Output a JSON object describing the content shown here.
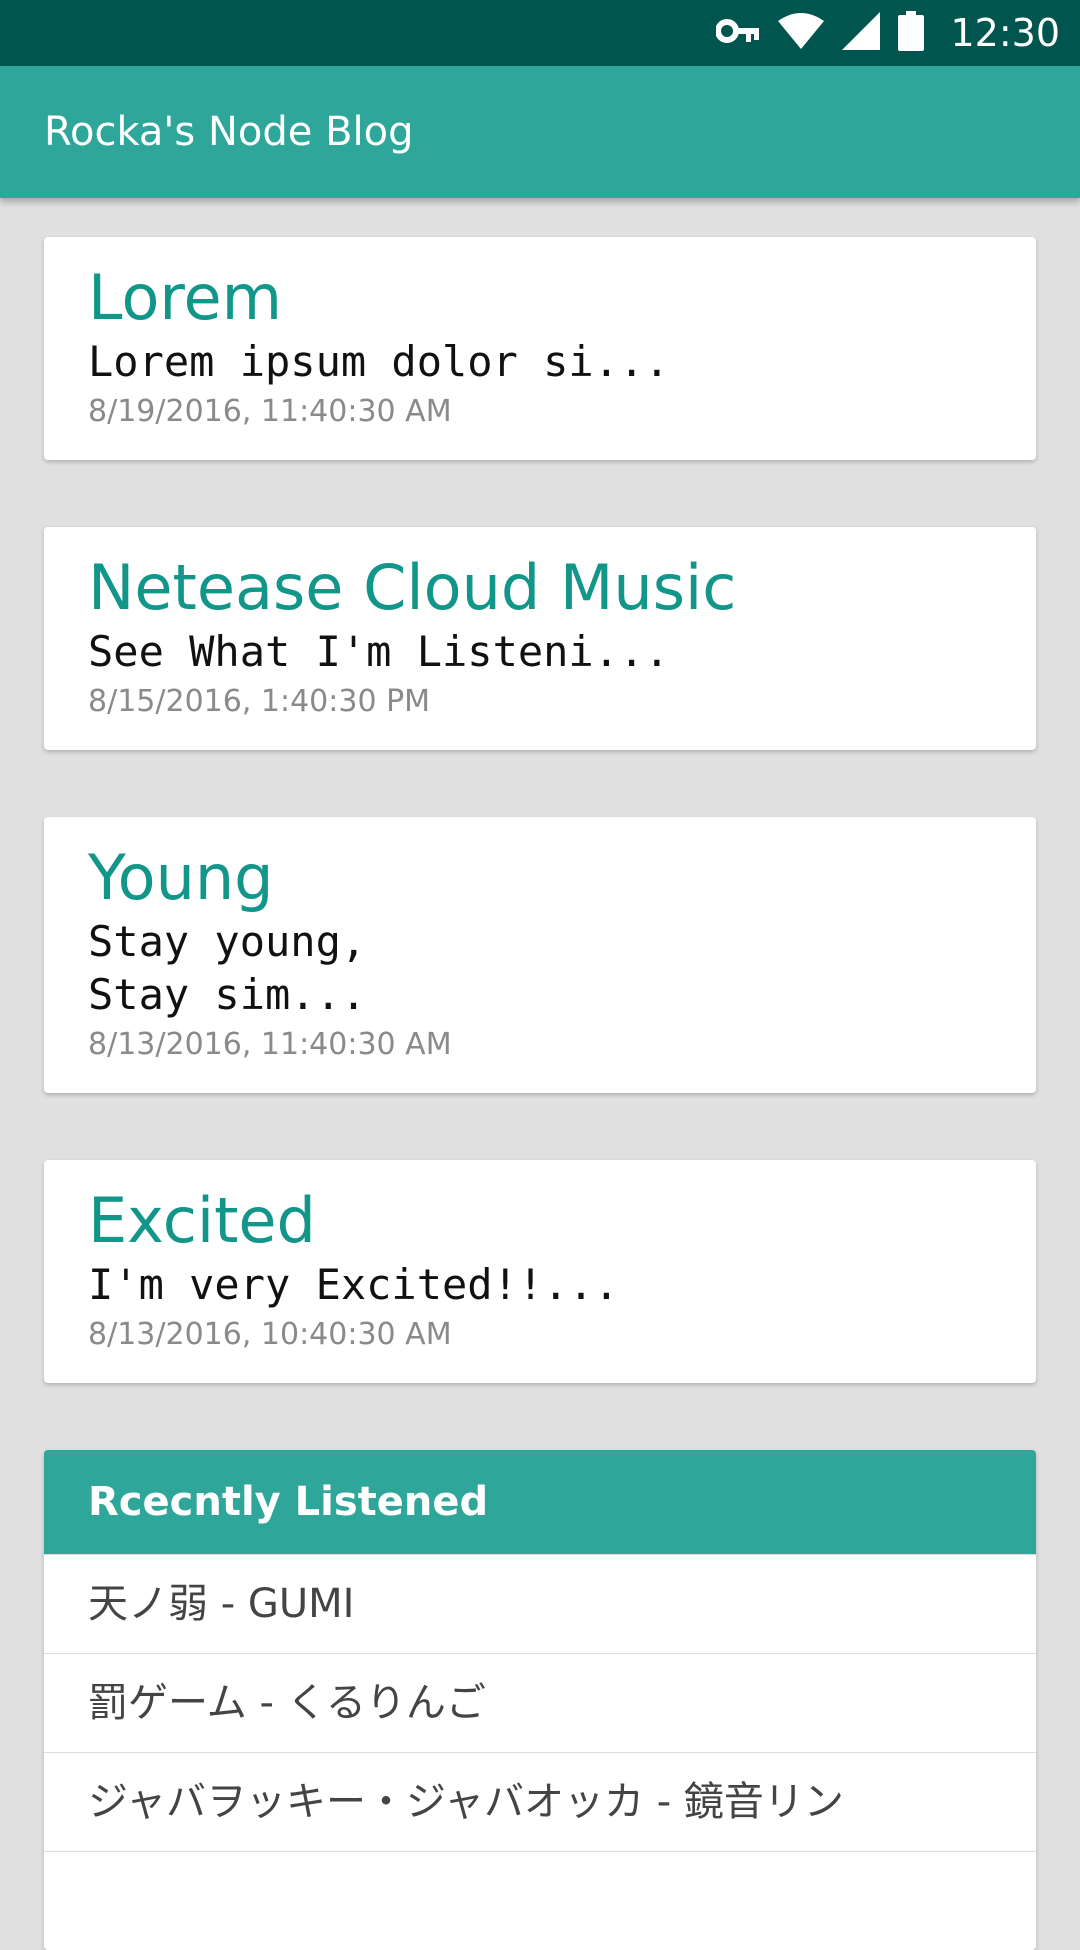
{
  "status_bar": {
    "icons": [
      "vpn-key-icon",
      "wifi-icon",
      "cellular-signal-icon",
      "battery-icon"
    ],
    "time": "12:30"
  },
  "app_bar": {
    "title": "Rocka's Node Blog"
  },
  "posts": [
    {
      "title": "Lorem",
      "excerpt": "Lorem ipsum dolor si...",
      "date": "8/19/2016, 11:40:30 AM"
    },
    {
      "title": "Netease Cloud Music",
      "excerpt": "See What I'm Listeni...",
      "date": "8/15/2016, 1:40:30 PM"
    },
    {
      "title": "Young",
      "excerpt": "Stay young,\nStay sim...",
      "date": "8/13/2016, 11:40:30 AM"
    },
    {
      "title": "Excited",
      "excerpt": "I'm very Excited!!...",
      "date": "8/13/2016, 10:40:30 AM"
    }
  ],
  "recently_listened": {
    "header": "Rcecntly Listened",
    "items": [
      "天ノ弱 - GUMI",
      "罰ゲーム - くるりんご",
      "ジャバヲッキー・ジャバオッカ - 鏡音リン"
    ]
  },
  "colors": {
    "status_bar": "#00564f",
    "primary": "#2fa69a",
    "title_text": "#12968a",
    "background": "#e0e0e0"
  }
}
